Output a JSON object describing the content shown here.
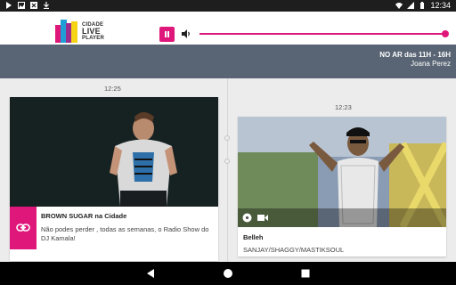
{
  "status_bar": {
    "time": "12:34",
    "left_icons": [
      "play-store-icon",
      "photo-icon",
      "x-icon",
      "download-icon"
    ],
    "right_icons": [
      "wifi-icon",
      "signal-icon",
      "battery-icon"
    ]
  },
  "player": {
    "logo_line1": "CIDADE",
    "logo_line2": "LIVE",
    "logo_line3": "PLAYER",
    "pause_icon": "pause-icon",
    "volume_icon": "volume-icon",
    "volume_level": 1.0,
    "accent_color": "#e0177a"
  },
  "on_air": {
    "schedule": "NO AR das 11H - 16H",
    "host": "Joana Perez",
    "background": "#596574"
  },
  "timeline": {
    "items": [
      {
        "time": "12:25",
        "title": "BROWN SUGAR na Cidade",
        "description": "Não podes perder , todas as semanas, o Radio Show do DJ Kamala!",
        "action_icon": "link-icon"
      },
      {
        "time": "12:23",
        "title": "Belleh",
        "subtitle": "SANJAY/SHAGGY/MASTIKSOUL",
        "media_icons": [
          "disc-icon",
          "video-camera-icon"
        ]
      }
    ]
  },
  "nav_bar": {
    "icons": [
      "back-icon",
      "home-icon",
      "recents-icon"
    ]
  }
}
